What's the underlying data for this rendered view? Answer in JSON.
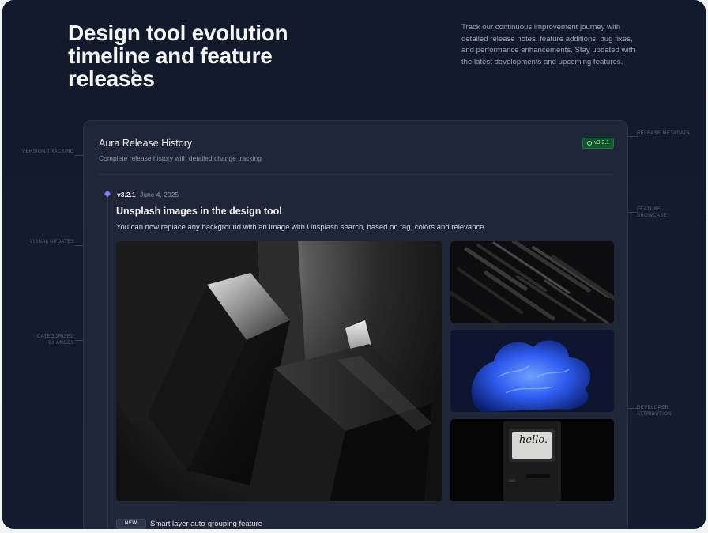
{
  "hero": {
    "title": "Design tool evolution timeline and feature releases",
    "description": "Track our continuous improvement journey with detailed release notes, feature additions, bug fixes, and performance enhancements. Stay updated with the latest developments and upcoming features."
  },
  "side_labels": {
    "left": [
      "VERSION TRACKING",
      "VISUAL UPDATES",
      "CATEGORIZED CHANGES"
    ],
    "right": [
      "RELEASE METADATA",
      "FEATURE SHOWCASE",
      "DEVELOPER ATTRIBUTION"
    ]
  },
  "card": {
    "title": "Aura Release History",
    "subtitle": "Complete release history with detailed change tracking",
    "badge": "v3.2.1"
  },
  "release": {
    "version": "v3.2.1",
    "date": "June 4, 2025",
    "feature_title": "Unsplash images in the design tool",
    "feature_description": "You can now replace any background with an image with Unsplash search, based on tag, colors and relevance.",
    "images": [
      "abstract-blocks-image",
      "black-bars-image",
      "blue-sculpture-image",
      "vintage-computer-image"
    ],
    "computer_screen_text": "hello."
  },
  "next_item": {
    "badge": "NEW",
    "title": "Smart layer auto-grouping feature"
  },
  "colors": {
    "background": "#131a2c",
    "card": "#1e2638",
    "accent": "#8b7cf6",
    "badge_green": "#86efac"
  }
}
